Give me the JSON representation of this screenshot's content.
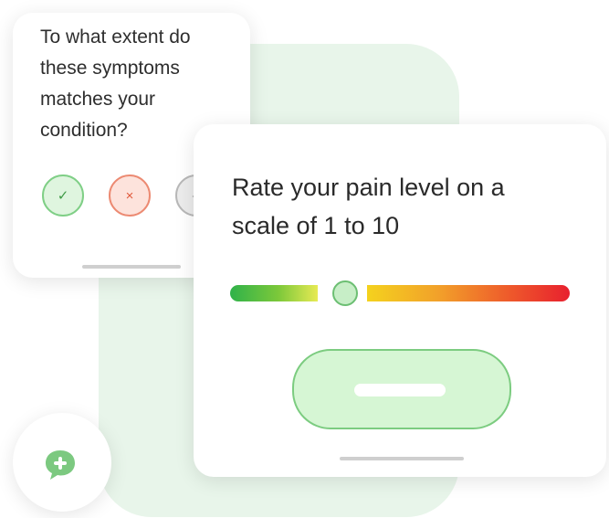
{
  "symptom_card": {
    "question": "To what extent do\nthese symptoms\nmatches your\ncondition?",
    "yes_glyph": "✓",
    "no_glyph": "×",
    "maybe_glyph": "–"
  },
  "pain_card": {
    "question": "Rate your pain level on a scale of 1 to 10",
    "slider": {
      "min": 1,
      "max": 10,
      "value": 4
    },
    "submit_label": ""
  },
  "colors": {
    "accent_green": "#7cc980",
    "accent_red": "#ec8a72",
    "background_tint": "#e8f5ea"
  },
  "icons": {
    "chat": "chat-add-icon"
  }
}
